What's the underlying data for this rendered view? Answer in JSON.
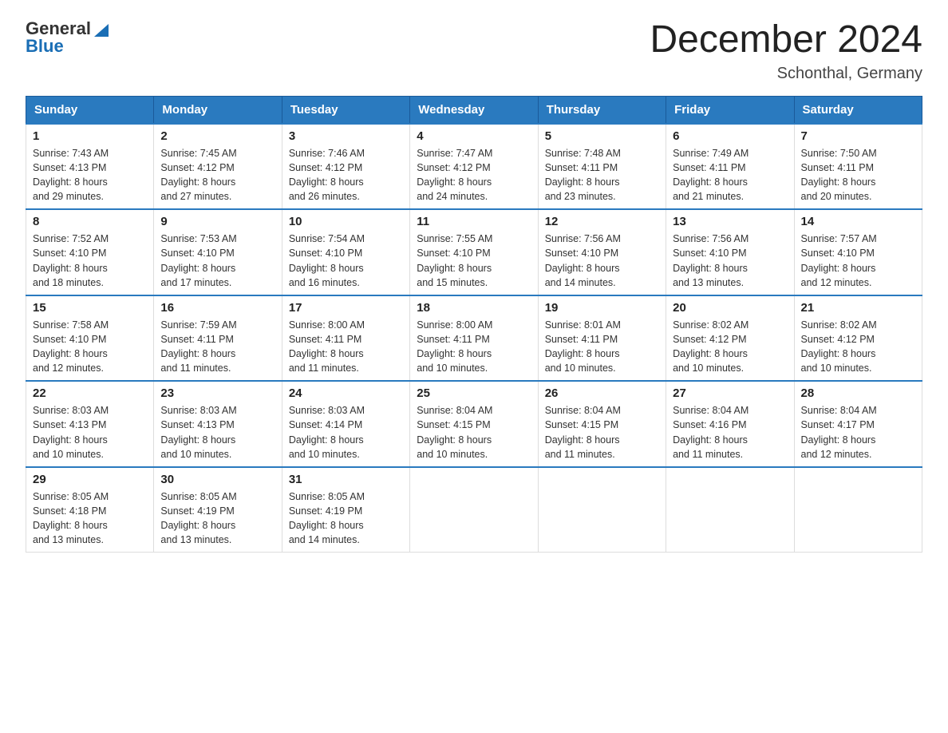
{
  "header": {
    "logo": {
      "text_general": "General",
      "text_blue": "Blue"
    },
    "title": "December 2024",
    "location": "Schonthal, Germany"
  },
  "days_of_week": [
    "Sunday",
    "Monday",
    "Tuesday",
    "Wednesday",
    "Thursday",
    "Friday",
    "Saturday"
  ],
  "weeks": [
    [
      {
        "day": "1",
        "sunrise": "7:43 AM",
        "sunset": "4:13 PM",
        "daylight": "8 hours and 29 minutes."
      },
      {
        "day": "2",
        "sunrise": "7:45 AM",
        "sunset": "4:12 PM",
        "daylight": "8 hours and 27 minutes."
      },
      {
        "day": "3",
        "sunrise": "7:46 AM",
        "sunset": "4:12 PM",
        "daylight": "8 hours and 26 minutes."
      },
      {
        "day": "4",
        "sunrise": "7:47 AM",
        "sunset": "4:12 PM",
        "daylight": "8 hours and 24 minutes."
      },
      {
        "day": "5",
        "sunrise": "7:48 AM",
        "sunset": "4:11 PM",
        "daylight": "8 hours and 23 minutes."
      },
      {
        "day": "6",
        "sunrise": "7:49 AM",
        "sunset": "4:11 PM",
        "daylight": "8 hours and 21 minutes."
      },
      {
        "day": "7",
        "sunrise": "7:50 AM",
        "sunset": "4:11 PM",
        "daylight": "8 hours and 20 minutes."
      }
    ],
    [
      {
        "day": "8",
        "sunrise": "7:52 AM",
        "sunset": "4:10 PM",
        "daylight": "8 hours and 18 minutes."
      },
      {
        "day": "9",
        "sunrise": "7:53 AM",
        "sunset": "4:10 PM",
        "daylight": "8 hours and 17 minutes."
      },
      {
        "day": "10",
        "sunrise": "7:54 AM",
        "sunset": "4:10 PM",
        "daylight": "8 hours and 16 minutes."
      },
      {
        "day": "11",
        "sunrise": "7:55 AM",
        "sunset": "4:10 PM",
        "daylight": "8 hours and 15 minutes."
      },
      {
        "day": "12",
        "sunrise": "7:56 AM",
        "sunset": "4:10 PM",
        "daylight": "8 hours and 14 minutes."
      },
      {
        "day": "13",
        "sunrise": "7:56 AM",
        "sunset": "4:10 PM",
        "daylight": "8 hours and 13 minutes."
      },
      {
        "day": "14",
        "sunrise": "7:57 AM",
        "sunset": "4:10 PM",
        "daylight": "8 hours and 12 minutes."
      }
    ],
    [
      {
        "day": "15",
        "sunrise": "7:58 AM",
        "sunset": "4:10 PM",
        "daylight": "8 hours and 12 minutes."
      },
      {
        "day": "16",
        "sunrise": "7:59 AM",
        "sunset": "4:11 PM",
        "daylight": "8 hours and 11 minutes."
      },
      {
        "day": "17",
        "sunrise": "8:00 AM",
        "sunset": "4:11 PM",
        "daylight": "8 hours and 11 minutes."
      },
      {
        "day": "18",
        "sunrise": "8:00 AM",
        "sunset": "4:11 PM",
        "daylight": "8 hours and 10 minutes."
      },
      {
        "day": "19",
        "sunrise": "8:01 AM",
        "sunset": "4:11 PM",
        "daylight": "8 hours and 10 minutes."
      },
      {
        "day": "20",
        "sunrise": "8:02 AM",
        "sunset": "4:12 PM",
        "daylight": "8 hours and 10 minutes."
      },
      {
        "day": "21",
        "sunrise": "8:02 AM",
        "sunset": "4:12 PM",
        "daylight": "8 hours and 10 minutes."
      }
    ],
    [
      {
        "day": "22",
        "sunrise": "8:03 AM",
        "sunset": "4:13 PM",
        "daylight": "8 hours and 10 minutes."
      },
      {
        "day": "23",
        "sunrise": "8:03 AM",
        "sunset": "4:13 PM",
        "daylight": "8 hours and 10 minutes."
      },
      {
        "day": "24",
        "sunrise": "8:03 AM",
        "sunset": "4:14 PM",
        "daylight": "8 hours and 10 minutes."
      },
      {
        "day": "25",
        "sunrise": "8:04 AM",
        "sunset": "4:15 PM",
        "daylight": "8 hours and 10 minutes."
      },
      {
        "day": "26",
        "sunrise": "8:04 AM",
        "sunset": "4:15 PM",
        "daylight": "8 hours and 11 minutes."
      },
      {
        "day": "27",
        "sunrise": "8:04 AM",
        "sunset": "4:16 PM",
        "daylight": "8 hours and 11 minutes."
      },
      {
        "day": "28",
        "sunrise": "8:04 AM",
        "sunset": "4:17 PM",
        "daylight": "8 hours and 12 minutes."
      }
    ],
    [
      {
        "day": "29",
        "sunrise": "8:05 AM",
        "sunset": "4:18 PM",
        "daylight": "8 hours and 13 minutes."
      },
      {
        "day": "30",
        "sunrise": "8:05 AM",
        "sunset": "4:19 PM",
        "daylight": "8 hours and 13 minutes."
      },
      {
        "day": "31",
        "sunrise": "8:05 AM",
        "sunset": "4:19 PM",
        "daylight": "8 hours and 14 minutes."
      },
      null,
      null,
      null,
      null
    ]
  ],
  "labels": {
    "sunrise": "Sunrise:",
    "sunset": "Sunset:",
    "daylight": "Daylight:"
  }
}
